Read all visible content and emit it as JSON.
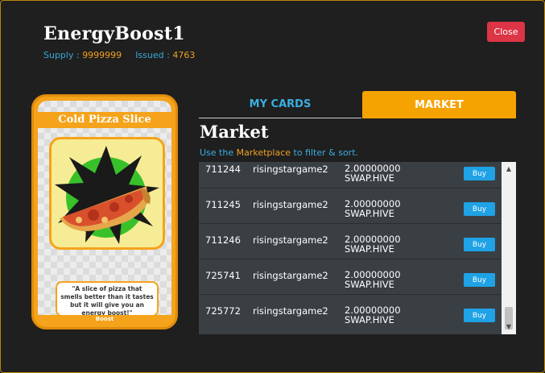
{
  "header": {
    "title": "EnergyBoost1",
    "supply_label": "Supply :",
    "supply_value": "9999999",
    "issued_label": "Issued :",
    "issued_value": "4763",
    "close_label": "Close"
  },
  "card": {
    "name": "Cold Pizza Slice",
    "quote": "\"A slice of pizza that smells better than it tastes but it will give you an energy boost!\"",
    "type": "Boost"
  },
  "tabs": [
    {
      "label": "MY CARDS",
      "active": false
    },
    {
      "label": "MARKET",
      "active": true
    }
  ],
  "market": {
    "title": "Market",
    "hint_prefix": "Use the ",
    "hint_link": "Marketplace",
    "hint_suffix": " to filter & sort."
  },
  "listings": [
    {
      "id": "711244",
      "seller": "risingstargame2",
      "price": "2.00000000",
      "token": "SWAP.HIVE",
      "buy_label": "Buy"
    },
    {
      "id": "711245",
      "seller": "risingstargame2",
      "price": "2.00000000",
      "token": "SWAP.HIVE",
      "buy_label": "Buy"
    },
    {
      "id": "711246",
      "seller": "risingstargame2",
      "price": "2.00000000",
      "token": "SWAP.HIVE",
      "buy_label": "Buy"
    },
    {
      "id": "725741",
      "seller": "risingstargame2",
      "price": "2.00000000",
      "token": "SWAP.HIVE",
      "buy_label": "Buy"
    },
    {
      "id": "725772",
      "seller": "risingstargame2",
      "price": "2.00000000",
      "token": "SWAP.HIVE",
      "buy_label": "Buy"
    }
  ],
  "icons": {
    "scroll_up": "▲",
    "scroll_down": "▼"
  },
  "colors": {
    "accent": "#f5a300",
    "link": "#3aaee0",
    "danger": "#dc3545",
    "buy": "#1fa2e6"
  }
}
